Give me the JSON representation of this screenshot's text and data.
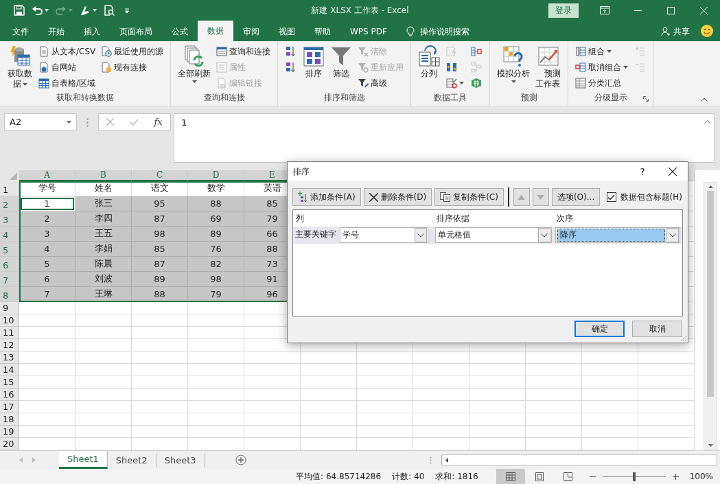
{
  "window": {
    "title": "新建 XLSX 工作表 - Excel",
    "sign_in": "登录"
  },
  "quick_access": [
    {
      "kind": "save",
      "disabled": false,
      "dropdown": false
    },
    {
      "kind": "undo",
      "disabled": false,
      "dropdown": true
    },
    {
      "kind": "redo",
      "disabled": true,
      "dropdown": true
    },
    {
      "kind": "pen",
      "disabled": false,
      "dropdown": true
    },
    {
      "kind": "preview",
      "disabled": false,
      "dropdown": false
    },
    {
      "kind": "customize",
      "disabled": false,
      "dropdown": false
    }
  ],
  "ribbon_tabs": [
    {
      "label": "文件",
      "selected": false
    },
    {
      "label": "开始",
      "selected": false
    },
    {
      "label": "插入",
      "selected": false
    },
    {
      "label": "页面布局",
      "selected": false
    },
    {
      "label": "公式",
      "selected": false
    },
    {
      "label": "数据",
      "selected": true
    },
    {
      "label": "审阅",
      "selected": false
    },
    {
      "label": "视图",
      "selected": false
    },
    {
      "label": "帮助",
      "selected": false
    },
    {
      "label": "WPS PDF",
      "selected": false
    }
  ],
  "tell_me": "操作说明搜索",
  "share": "共享",
  "ribbon": {
    "groups": [
      {
        "title": "获取和转换数据",
        "launcher": false,
        "columns": [
          [
            {
              "kind": "large",
              "label": "获取数据",
              "disabled": false,
              "dropdown": true
            }
          ],
          [
            {
              "kind": "small",
              "label": "从文本/CSV",
              "disabled": false,
              "dropdown": false
            },
            {
              "kind": "small",
              "label": "自网站",
              "disabled": false,
              "dropdown": false
            },
            {
              "kind": "small",
              "label": "自表格/区域",
              "disabled": false,
              "dropdown": false
            }
          ],
          [
            {
              "kind": "small",
              "label": "最近使用的源",
              "disabled": false,
              "dropdown": false
            },
            {
              "kind": "small",
              "label": "现有连接",
              "disabled": false,
              "dropdown": false
            }
          ]
        ]
      },
      {
        "title": "查询和连接",
        "launcher": false,
        "columns": [
          [
            {
              "kind": "large",
              "label": "全部刷新",
              "disabled": false,
              "dropdown": true
            }
          ],
          [
            {
              "kind": "small",
              "label": "查询和连接",
              "disabled": false,
              "dropdown": false
            },
            {
              "kind": "small",
              "label": "属性",
              "disabled": true,
              "dropdown": false
            },
            {
              "kind": "small",
              "label": "编辑链接",
              "disabled": true,
              "dropdown": false
            }
          ]
        ]
      },
      {
        "title": "排序和筛选",
        "launcher": false,
        "columns": [
          [
            {
              "kind": "icon",
              "disabled": false,
              "dropdown": false
            },
            {
              "kind": "icon",
              "disabled": false,
              "dropdown": false
            }
          ],
          [
            {
              "kind": "large",
              "label": "排序",
              "disabled": false,
              "dropdown": false
            }
          ],
          [
            {
              "kind": "large",
              "label": "筛选",
              "disabled": false,
              "dropdown": false
            }
          ],
          [
            {
              "kind": "small",
              "label": "清除",
              "disabled": true,
              "dropdown": false
            },
            {
              "kind": "small",
              "label": "重新应用",
              "disabled": true,
              "dropdown": false
            },
            {
              "kind": "small",
              "label": "高级",
              "disabled": false,
              "dropdown": false
            }
          ]
        ]
      },
      {
        "title": "数据工具",
        "launcher": false,
        "columns": [
          [
            {
              "kind": "large",
              "label": "分列",
              "disabled": false,
              "dropdown": false
            }
          ],
          [
            {
              "kind": "icon",
              "disabled": true,
              "dropdown": false
            },
            {
              "kind": "icon",
              "disabled": false,
              "dropdown": false
            },
            {
              "kind": "icon",
              "disabled": false,
              "dropdown": true
            }
          ],
          [
            {
              "kind": "icon",
              "disabled": false,
              "dropdown": false
            },
            {
              "kind": "icon",
              "disabled": true,
              "dropdown": false
            },
            {
              "kind": "icon",
              "disabled": false,
              "dropdown": false
            }
          ]
        ]
      },
      {
        "title": "预测",
        "launcher": false,
        "columns": [
          [
            {
              "kind": "large",
              "label": "模拟分析",
              "disabled": false,
              "dropdown": true
            }
          ],
          [
            {
              "kind": "large",
              "label": "预测工作表",
              "disabled": false,
              "dropdown": false
            }
          ]
        ]
      },
      {
        "title": "分级显示",
        "launcher": true,
        "columns": [
          [
            {
              "kind": "small",
              "label": "组合",
              "disabled": false,
              "dropdown": true
            },
            {
              "kind": "small",
              "label": "取消组合",
              "disabled": false,
              "dropdown": true
            },
            {
              "kind": "small",
              "label": "分类汇总",
              "disabled": false,
              "dropdown": false
            }
          ],
          [
            {
              "kind": "icon",
              "disabled": true,
              "dropdown": false
            },
            {
              "kind": "icon",
              "disabled": true,
              "dropdown": false
            }
          ]
        ]
      }
    ]
  },
  "formula_bar": {
    "name_box": "A2",
    "function_label": "fx",
    "value": "1"
  },
  "sheet": {
    "columns": [
      {
        "label": "A",
        "selected": true
      },
      {
        "label": "B",
        "selected": true
      },
      {
        "label": "C",
        "selected": true
      },
      {
        "label": "D",
        "selected": true
      },
      {
        "label": "E",
        "selected": true
      }
    ],
    "rows": [
      {
        "number": "1",
        "selected": false,
        "cells": [
          {
            "text": "学号",
            "active": false
          },
          {
            "text": "姓名",
            "active": false
          },
          {
            "text": "语文",
            "active": false
          },
          {
            "text": "数学",
            "active": false
          },
          {
            "text": "英语",
            "active": false
          }
        ]
      },
      {
        "number": "2",
        "selected": true,
        "cells": [
          {
            "text": "1",
            "active": true
          },
          {
            "text": "张三",
            "active": false
          },
          {
            "text": "95",
            "active": false
          },
          {
            "text": "88",
            "active": false
          },
          {
            "text": "85",
            "active": false
          }
        ]
      },
      {
        "number": "3",
        "selected": true,
        "cells": [
          {
            "text": "2",
            "active": false
          },
          {
            "text": "李四",
            "active": false
          },
          {
            "text": "87",
            "active": false
          },
          {
            "text": "69",
            "active": false
          },
          {
            "text": "79",
            "active": false
          }
        ]
      },
      {
        "number": "4",
        "selected": true,
        "cells": [
          {
            "text": "3",
            "active": false
          },
          {
            "text": "王五",
            "active": false
          },
          {
            "text": "98",
            "active": false
          },
          {
            "text": "89",
            "active": false
          },
          {
            "text": "66",
            "active": false
          }
        ]
      },
      {
        "number": "5",
        "selected": true,
        "cells": [
          {
            "text": "4",
            "active": false
          },
          {
            "text": "李娟",
            "active": false
          },
          {
            "text": "85",
            "active": false
          },
          {
            "text": "76",
            "active": false
          },
          {
            "text": "88",
            "active": false
          }
        ]
      },
      {
        "number": "6",
        "selected": true,
        "cells": [
          {
            "text": "5",
            "active": false
          },
          {
            "text": "陈晨",
            "active": false
          },
          {
            "text": "87",
            "active": false
          },
          {
            "text": "82",
            "active": false
          },
          {
            "text": "73",
            "active": false
          }
        ]
      },
      {
        "number": "7",
        "selected": true,
        "cells": [
          {
            "text": "6",
            "active": false
          },
          {
            "text": "刘波",
            "active": false
          },
          {
            "text": "89",
            "active": false
          },
          {
            "text": "98",
            "active": false
          },
          {
            "text": "91",
            "active": false
          }
        ]
      },
      {
        "number": "8",
        "selected": true,
        "cells": [
          {
            "text": "7",
            "active": false
          },
          {
            "text": "王琳",
            "active": false
          },
          {
            "text": "88",
            "active": false
          },
          {
            "text": "79",
            "active": false
          },
          {
            "text": "96",
            "active": false
          }
        ]
      },
      {
        "number": "9",
        "selected": false
      },
      {
        "number": "10",
        "selected": false
      },
      {
        "number": "11",
        "selected": false
      },
      {
        "number": "12",
        "selected": false
      },
      {
        "number": "13",
        "selected": false
      },
      {
        "number": "14",
        "selected": false
      },
      {
        "number": "15",
        "selected": false
      },
      {
        "number": "16",
        "selected": false
      },
      {
        "number": "17",
        "selected": false
      },
      {
        "number": "18",
        "selected": false
      },
      {
        "number": "19",
        "selected": false
      },
      {
        "number": "20",
        "selected": false
      }
    ]
  },
  "sheet_tabs": [
    {
      "label": "Sheet1",
      "selected": true
    },
    {
      "label": "Sheet2",
      "selected": false
    },
    {
      "label": "Sheet3",
      "selected": false
    }
  ],
  "status_bar": {
    "stats": [
      "平均值: 64.85714286",
      "计数: 40",
      "求和: 1816"
    ],
    "views": [
      {
        "kind": "normal",
        "selected": true
      },
      {
        "kind": "page_layout",
        "selected": false
      },
      {
        "kind": "page_break",
        "selected": false
      }
    ],
    "zoom": {
      "level": 0.5,
      "reading": "100%"
    }
  },
  "dialog": {
    "title": "排序",
    "help": "?",
    "toolbar": [
      {
        "kind": "add",
        "label": "添加条件(A)",
        "disabled": false
      },
      {
        "kind": "delete",
        "label": "删除条件(D)",
        "disabled": false
      },
      {
        "kind": "copy",
        "label": "复制条件(C)",
        "disabled": false
      },
      {
        "kind": "up",
        "disabled": true
      },
      {
        "kind": "down",
        "disabled": true
      },
      {
        "kind": "options",
        "label": "选项(O)...",
        "disabled": false
      }
    ],
    "header_checkbox": {
      "label": "数据包含标题(H)",
      "checked": true
    },
    "columns": [
      "列",
      "排序依据",
      "次序"
    ],
    "levels": [
      {
        "label": "主要关键字",
        "column": "学号",
        "sort_on": "单元格值",
        "order": "降序",
        "selected": true
      }
    ],
    "buttons": [
      {
        "label": "确定",
        "default": true
      },
      {
        "label": "取消",
        "default": false
      }
    ]
  }
}
